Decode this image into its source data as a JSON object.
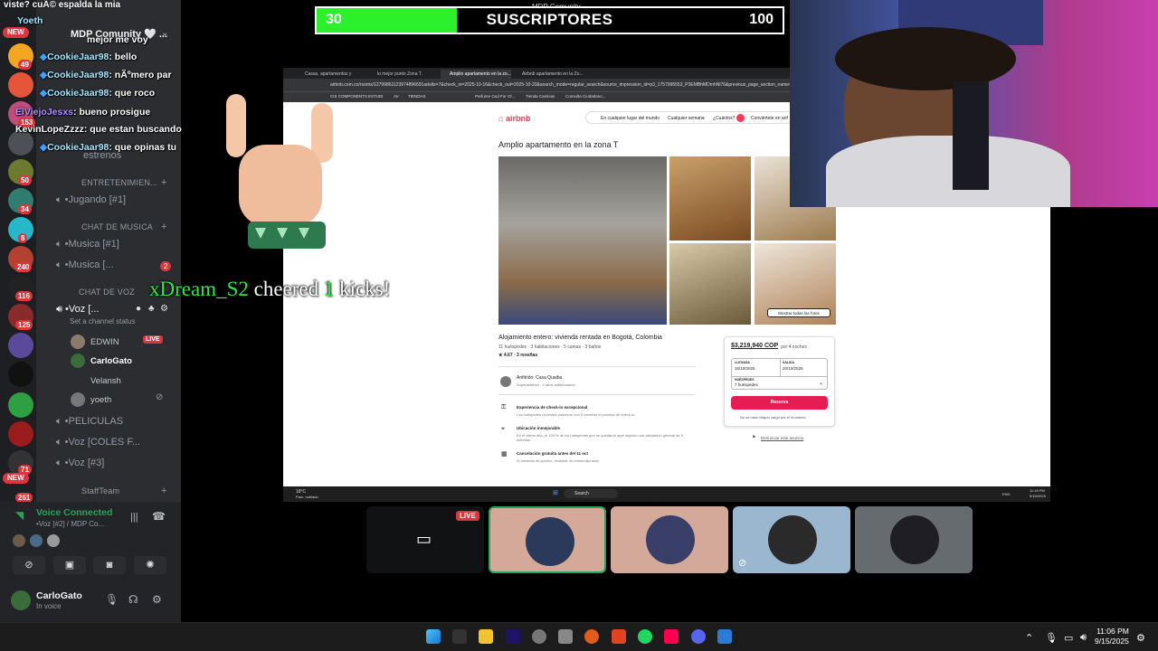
{
  "chat": {
    "top_line": "viste? cuÃ© espalda la mia",
    "lines": [
      {
        "name": "Yoeth",
        "text": ""
      },
      {
        "name": "",
        "text": "mejor me voy"
      },
      {
        "name": "CookieJaar98",
        "text": ": bello"
      },
      {
        "name": "CookieJaar98",
        "text": ": nÃºmero par"
      },
      {
        "name": "CookieJaar98",
        "text": ": que roco"
      },
      {
        "name": "ElViejoJesxs",
        "text": ": bueno prosigue"
      },
      {
        "name": "KevinLopeZzzz",
        "text": ": que estan buscando"
      },
      {
        "name": "CookieJaar98",
        "text": ": que opinas tu"
      }
    ]
  },
  "cheer": {
    "name": "xDream_S2",
    "word1": "cheered",
    "amount": "1",
    "word2": "kicks!"
  },
  "goal": {
    "current": "30",
    "label": "SUSCRIPTORES",
    "max": "100",
    "progress": 0.3,
    "top_label": "MDP Comunity"
  },
  "discord": {
    "server_name": "MDP Comunity 🤍 ...",
    "badges": {
      "new": "NEW",
      "rail_counts": [
        "49",
        "153",
        "50",
        "34",
        "8",
        "240",
        "116",
        "125",
        "71",
        "261"
      ]
    },
    "channels": [
      {
        "kind": "chan",
        "label": "estrenos"
      },
      {
        "kind": "cat",
        "label": "ENTRETENIMIEN..."
      },
      {
        "kind": "chan",
        "label": "•Jugando [#1]"
      },
      {
        "kind": "cat",
        "label": "CHAT DE MUSICA"
      },
      {
        "kind": "chan",
        "label": "•Musica [#1]"
      },
      {
        "kind": "chan",
        "label": "•Musica [..."
      },
      {
        "kind": "cat",
        "label": "CHAT DE VOZ"
      },
      {
        "kind": "chan",
        "label": "•Voz [..."
      },
      {
        "kind": "chan",
        "label": "•PELICULAS"
      },
      {
        "kind": "chan",
        "label": "•Voz [COLES F..."
      },
      {
        "kind": "chan",
        "label": "•Voz [#3]"
      },
      {
        "kind": "cat",
        "label": "StaffTeam"
      }
    ],
    "channel_status": "Set a channel status",
    "musica_unread": "2",
    "members": [
      {
        "name": "EDWIN",
        "live": "LIVE"
      },
      {
        "name": "CarloGato",
        "live": ""
      },
      {
        "name": "Velansh",
        "live": ""
      },
      {
        "name": "yoeth",
        "live": ""
      }
    ],
    "voice": {
      "title": "Voice Connected",
      "subtitle": "•Voz [#2] / MDP Co..."
    },
    "user": {
      "name": "CarloGato",
      "status": "In voice"
    }
  },
  "browser": {
    "tabs": [
      "Casas, apartamentos y alquile...",
      "lo mejor punto Zona T. Buena...",
      "Amplio apartamento en la zo...",
      "Airbnb apartamento en la Zo..."
    ],
    "active_tab": 2,
    "url": "airbnb.com.co/rooms/12799861123974896691adults=7&check_in=2025-10-16&check_out=2025-10-20&search_mode=regular_search&source_impression_id=p3_1757995553_P3EMBhMDmhNl76&previous_page_section_name=1000",
    "bookmarks": [
      "CIS COMPONENTS",
      "ESTUDI",
      "AV",
      "TIENDAS",
      "Perfume Oud For Gl...",
      "Tienda Camisas",
      "Consulta Ciudadano..."
    ],
    "search": {
      "where": "En cualquier lugar del mundo",
      "when": "Cualquier semana",
      "who": "¿Cuántos?",
      "host": "Conviértete en anf"
    },
    "listing_title": "Amplio apartamento en la zona T",
    "show_all": "Mostrar todas las fotos",
    "heading": "Alojamiento entero: vivienda rentada en Bogotá, Colombia",
    "meta": "11 huéspedes · 3 habitaciones · 5 camas · 3 baños",
    "rating": "★ 4.67 · 3 reseñas",
    "host": "Anfitrión: Casa Quaiba",
    "host_sub": "Superanfitrión · 2 años anfitrionando",
    "features": [
      {
        "title": "Experiencia de check-in excepcional",
        "text": "Los huéspedes recientes valoraron con 5 estrellas el proceso de check-in."
      },
      {
        "title": "Ubicación inmejorable",
        "text": "En el último año, el 100 % de los huéspedes que se quedaron aquí dejaron una valoración general de 5 estrellas."
      },
      {
        "title": "Cancelación gratuita antes del 11 oct",
        "text": "Si cambias de opinión, recibirás un reembolso total."
      }
    ],
    "booking": {
      "price": "$3,219,940 COP",
      "price_sub": "por 4 noches",
      "checkin_label": "LLEGADA",
      "checkin": "16/10/2025",
      "checkout_label": "SALIDA",
      "checkout": "20/10/2025",
      "guests_label": "HUÉSPEDES",
      "guests": "7 huéspedes",
      "reserve": "Reserva",
      "no_charge": "No se hará ningún cargo por el momento",
      "report": "Denunciar este anuncio"
    },
    "taskbar": {
      "weather": "18°C",
      "weather_sub": "Parc. nublado",
      "search": "Search",
      "lang": "ENG",
      "time": "11:18 PM",
      "date": "9/15/2025"
    }
  },
  "stage": {
    "live": "LIVE"
  },
  "taskbar": {
    "time": "11:06 PM",
    "date": "9/15/2025"
  },
  "colors": {
    "accent_green": "#2cf02c",
    "discord_bg": "#2b2d31",
    "airbnb": "#ff385c",
    "reserve": "#e51d53",
    "live_red": "#da373c"
  }
}
